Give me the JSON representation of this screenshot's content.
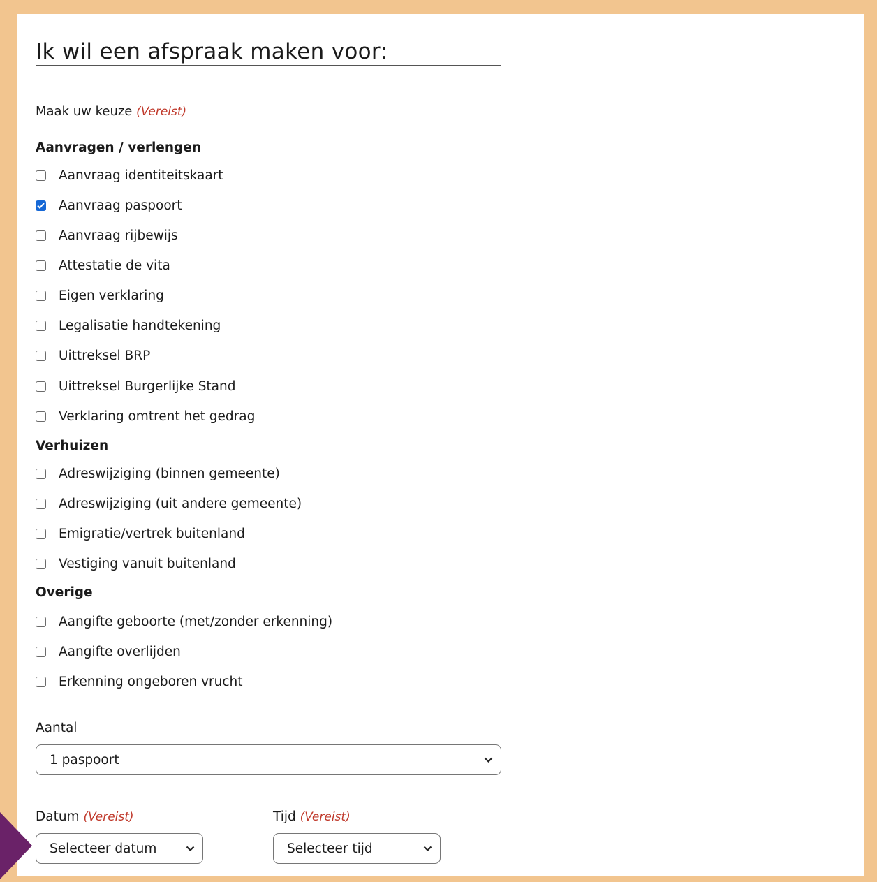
{
  "form": {
    "title": "Ik wil een afspraak maken voor:",
    "choose_label": "Maak uw keuze",
    "required_marker": "(Vereist)",
    "groups": [
      {
        "title": "Aanvragen / verlengen",
        "options": [
          {
            "label": "Aanvraag identiteitskaart",
            "checked": false
          },
          {
            "label": "Aanvraag paspoort",
            "checked": true
          },
          {
            "label": "Aanvraag rijbewijs",
            "checked": false
          },
          {
            "label": "Attestatie de vita",
            "checked": false
          },
          {
            "label": "Eigen verklaring",
            "checked": false
          },
          {
            "label": "Legalisatie handtekening",
            "checked": false
          },
          {
            "label": "Uittreksel BRP",
            "checked": false
          },
          {
            "label": "Uittreksel Burgerlijke Stand",
            "checked": false
          },
          {
            "label": "Verklaring omtrent het gedrag",
            "checked": false
          }
        ]
      },
      {
        "title": "Verhuizen",
        "options": [
          {
            "label": "Adreswijziging (binnen gemeente)",
            "checked": false
          },
          {
            "label": "Adreswijziging (uit andere gemeente)",
            "checked": false
          },
          {
            "label": "Emigratie/vertrek buitenland",
            "checked": false
          },
          {
            "label": "Vestiging vanuit buitenland",
            "checked": false
          }
        ]
      },
      {
        "title": "Overige",
        "options": [
          {
            "label": "Aangifte geboorte (met/zonder erkenning)",
            "checked": false
          },
          {
            "label": "Aangifte overlijden",
            "checked": false
          },
          {
            "label": "Erkenning ongeboren vrucht",
            "checked": false
          }
        ]
      }
    ],
    "quantity": {
      "label": "Aantal",
      "value": "1 paspoort"
    },
    "date": {
      "label": "Datum",
      "required": "(Vereist)",
      "value": "Selecteer datum"
    },
    "time": {
      "label": "Tijd",
      "required": "(Vereist)",
      "value": "Selecteer tijd"
    }
  },
  "colors": {
    "border": "#f2c58f",
    "required": "#c0392b",
    "checkbox_checked": "#1668d6",
    "marker": "#6a2268"
  }
}
